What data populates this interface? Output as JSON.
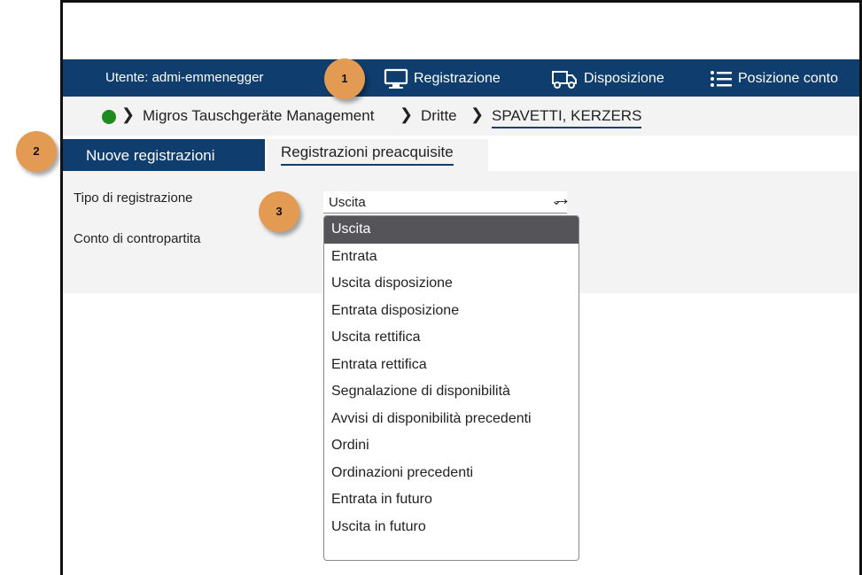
{
  "topbar": {
    "user_label": "Utente: admi-emmenegger",
    "nav": [
      {
        "label": "Registrazione",
        "icon": "monitor-icon"
      },
      {
        "label": "Disposizione",
        "icon": "truck-icon"
      },
      {
        "label": "Posizione conto",
        "icon": "list-icon"
      }
    ]
  },
  "breadcrumb": {
    "status_color": "#1f8a1f",
    "items": [
      "Migros Tauschgeräte Management",
      "Dritte",
      "SPAVETTI, KERZERS"
    ]
  },
  "tabs": [
    "Nuove registrazioni",
    "Registrazioni preacquisite"
  ],
  "form": {
    "label_type": "Tipo di registrazione",
    "label_account": "Conto di contropartita",
    "selected_value": "Uscita"
  },
  "dropdown_options": [
    "Uscita",
    "Entrata",
    "Uscita disposizione",
    "Entrata disposizione",
    "Uscita rettifica",
    "Entrata rettifica",
    "Segnalazione di disponibilità",
    "Avvisi di disponibilità precedenti",
    "Ordini",
    "Ordinazioni precedenti",
    "Entrata in futuro",
    "Uscita in futuro"
  ],
  "badges": [
    "1",
    "2",
    "3"
  ],
  "colors": {
    "nav_bg": "#0f3e6e",
    "badge": "#e39a52",
    "selected_option_bg": "#555559"
  }
}
